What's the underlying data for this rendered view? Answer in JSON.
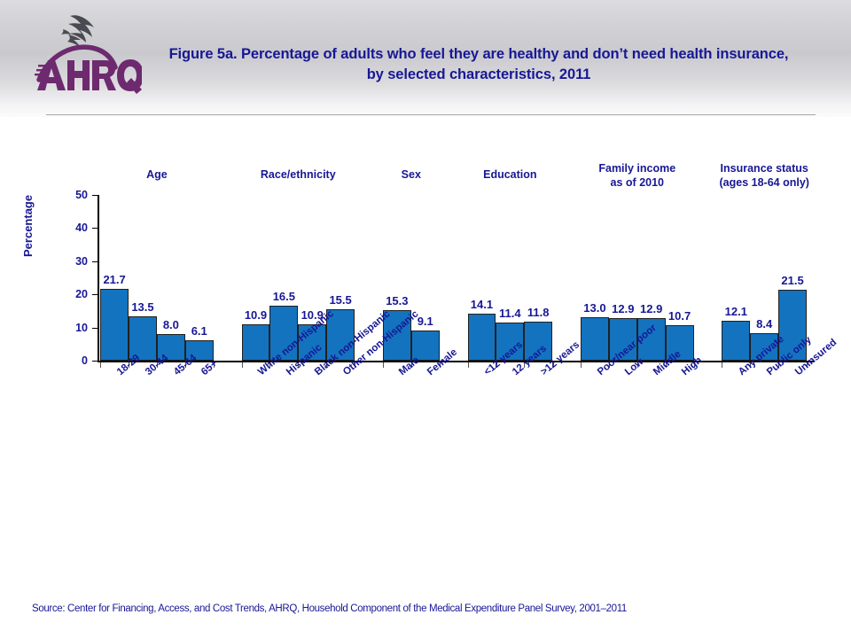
{
  "header": {
    "logo_alt": "AHRQ Agency for Healthcare Research and Quality",
    "logo_wordmark": "AHRQ",
    "title": "Figure 5a. Percentage of adults who feel they are healthy and don’t need health insurance, by selected characteristics, 2011"
  },
  "source": {
    "text": "Source: Center for Financing, Access, and Cost Trends, AHRQ, Household Component of the Medical Expenditure Panel Survey,  2001–2011"
  },
  "chart_data": {
    "type": "bar",
    "title": "Figure 5a. Percentage of adults who feel they are healthy and don’t need health insurance, by selected characteristics, 2011",
    "xlabel": "",
    "ylabel": "Percentage",
    "ylim": [
      0,
      50
    ],
    "yticks": [
      0,
      10,
      20,
      30,
      40,
      50
    ],
    "ytick_labels": [
      "0",
      "10",
      "20",
      "30",
      "40",
      "50"
    ],
    "grid": false,
    "legend": "none",
    "bar_color": "#1373BF",
    "bar_edge_color": "#202020",
    "label_color": "#171795",
    "groups": [
      {
        "name": "Age",
        "header": "Age",
        "categories": [
          "18-29",
          "30-44",
          "45-64",
          "65+"
        ],
        "values": [
          21.7,
          13.5,
          8.0,
          6.1
        ],
        "value_labels": [
          "21.7",
          "13.5",
          "8.0",
          "6.1"
        ]
      },
      {
        "name": "Race/ethnicity",
        "header": "Race/ethnicity",
        "categories": [
          "White non-Hispanic",
          "Hispanic",
          "Black non-Hispanic",
          "Other non-Hispanic"
        ],
        "values": [
          10.9,
          16.5,
          10.9,
          15.5
        ],
        "value_labels": [
          "10.9",
          "16.5",
          "10.9",
          "15.5"
        ]
      },
      {
        "name": "Sex",
        "header": "Sex",
        "categories": [
          "Male",
          "Female"
        ],
        "values": [
          15.3,
          9.1
        ],
        "value_labels": [
          "15.3",
          "9.1"
        ]
      },
      {
        "name": "Education",
        "header": "Education",
        "categories": [
          "<12 years",
          "12 years",
          ">12 years"
        ],
        "values": [
          14.1,
          11.4,
          11.8
        ],
        "value_labels": [
          "14.1",
          "11.4",
          "11.8"
        ]
      },
      {
        "name": "Family income as of 2010",
        "header": "Family income\nas of 2010",
        "categories": [
          "Poor/near poor",
          "Low",
          "Middle",
          "High"
        ],
        "values": [
          13.0,
          12.9,
          12.9,
          10.7
        ],
        "value_labels": [
          "13.0",
          "12.9",
          "12.9",
          "10.7"
        ]
      },
      {
        "name": "Insurance status (ages 18-64 only)",
        "header": "Insurance status\n(ages 18-64  only)",
        "categories": [
          "Any private",
          "Public only",
          "Uninsured"
        ],
        "values": [
          12.1,
          8.4,
          21.5
        ],
        "value_labels": [
          "12.1",
          "8.4",
          "21.5"
        ]
      }
    ]
  }
}
